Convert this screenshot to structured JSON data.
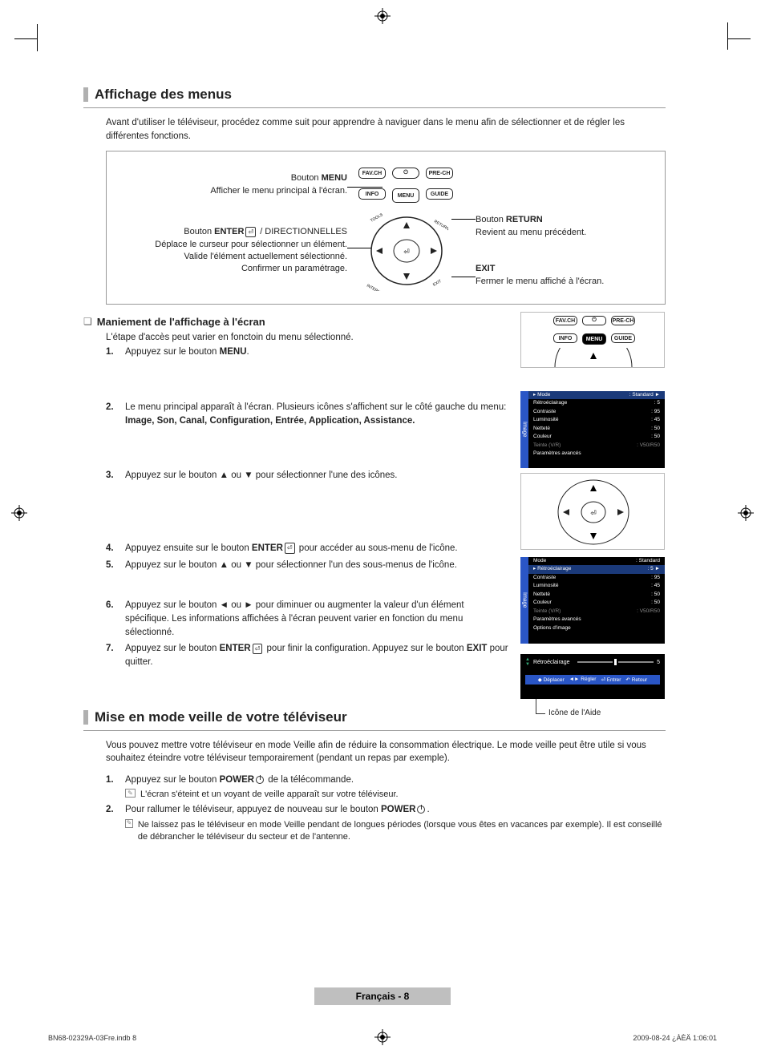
{
  "reg_icon_name": "registration-mark-icon",
  "section1": {
    "title": "Affichage des menus",
    "intro": "Avant d'utiliser le téléviseur, procédez comme suit pour apprendre à naviguer dans le menu afin de sélectionner et de régler les différentes fonctions.",
    "remote": {
      "menu_btn_label": "Bouton ",
      "menu_btn_bold": "MENU",
      "menu_btn_desc": "Afficher le menu principal à l'écran.",
      "enter_btn_label": "Bouton ",
      "enter_btn_bold": "ENTER",
      "enter_btn_suffix": " / DIRECTIONNELLES",
      "enter_desc1": "Déplace le curseur pour sélectionner un élément.",
      "enter_desc2": "Valide l'élément actuellement sélectionné.",
      "enter_desc3": "Confirmer un paramétrage.",
      "return_label": "Bouton ",
      "return_bold": "RETURN",
      "return_desc": "Revient au menu précédent.",
      "exit_bold": "EXIT",
      "exit_desc": "Fermer le menu affiché à l'écran.",
      "btn_favch": "FAV.CH",
      "btn_prech": "PRE-CH",
      "btn_info": "INFO",
      "btn_menu": "MENU",
      "btn_guide": "GUIDE",
      "btn_tools": "TOOLS",
      "btn_return": "RETURN",
      "btn_internet": "INTERNET",
      "btn_exit": "EXIT"
    },
    "sub_title": "Maniement de l'affichage à l'écran",
    "sub_intro": "L'étape d'accès peut varier en fonctoin du menu sélectionné.",
    "steps": {
      "s1a": "Appuyez sur le bouton ",
      "s1b": "MENU",
      "s1c": ".",
      "s2a": "Le menu principal apparaît à l'écran. Plusieurs icônes s'affichent sur le côté gauche du menu: ",
      "s2b": "Image, Son, Canal, Configuration, Entrée, Application, Assistance.",
      "s3": "Appuyez sur le bouton ▲ ou ▼ pour sélectionner l'une des icônes.",
      "s4a": "Appuyez ensuite sur le bouton ",
      "s4b": "ENTER",
      "s4c": " pour accéder au sous-menu de l'icône.",
      "s5": "Appuyez sur le bouton ▲ ou ▼  pour sélectionner l'un des sous-menus de l'icône.",
      "s6": "Appuyez sur le bouton ◄ ou ► pour diminuer ou augmenter la valeur d'un élément spécifique. Les informations affichées à l'écran peuvent varier en fonction du menu sélectionné.",
      "s7a": "Appuyez sur le bouton ",
      "s7b": "ENTER",
      "s7c": " pour finir la configuration. Appuyez sur le bouton ",
      "s7d": "EXIT",
      "s7e": " pour quitter."
    },
    "menu1": {
      "tab": "Image",
      "rows": [
        {
          "l": "Mode",
          "r": ": Standard",
          "hl": true
        },
        {
          "l": "Rétroéclairage",
          "r": ": 5"
        },
        {
          "l": "Contraste",
          "r": ": 95"
        },
        {
          "l": "Luminosité",
          "r": ": 45"
        },
        {
          "l": "Netteté",
          "r": ": 50"
        },
        {
          "l": "Couleur",
          "r": ": 50"
        },
        {
          "l": "Teinte (V/R)",
          "r": ": V50/R50",
          "dim": true
        },
        {
          "l": "Paramètres avancés",
          "r": ""
        }
      ]
    },
    "menu2": {
      "tab": "Image",
      "rows": [
        {
          "l": "Mode",
          "r": ": Standard"
        },
        {
          "l": "Rétroéclairage",
          "r": ": 5",
          "hl": true
        },
        {
          "l": "Contraste",
          "r": ": 95"
        },
        {
          "l": "Luminosité",
          "r": ": 45"
        },
        {
          "l": "Netteté",
          "r": ": 50"
        },
        {
          "l": "Couleur",
          "r": ": 50"
        },
        {
          "l": "Teinte (V/R)",
          "r": ": V50/R50",
          "dim": true
        },
        {
          "l": "Paramètres avancés",
          "r": ""
        },
        {
          "l": "Options d'image",
          "r": ""
        }
      ]
    },
    "slider": {
      "label": "Rétroéclairage",
      "val": "5",
      "help1": "Déplacer",
      "help2": "Régler",
      "help3": "Entrer",
      "help4": "Retour"
    },
    "aide_label": "Icône de l'Aide"
  },
  "section2": {
    "title": "Mise en mode veille de votre téléviseur",
    "intro": "Vous pouvez mettre votre téléviseur en mode Veille afin de réduire la consommation électrique. Le mode veille peut être utile si vous souhaitez éteindre votre téléviseur temporairement (pendant un repas par exemple).",
    "s1a": "Appuyez sur le bouton  ",
    "s1b": "POWER",
    "s1c": " de la télécommande.",
    "n1": "L'écran s'éteint et un voyant de veille apparaît sur votre téléviseur.",
    "s2a": "Pour rallumer le téléviseur, appuyez de nouveau sur le bouton ",
    "s2b": "POWER",
    "s2c": ".",
    "n2": "Ne laissez pas le téléviseur en mode Veille pendant de longues périodes (lorsque vous êtes en vacances par exemple). Il est conseillé de débrancher le téléviseur du secteur et de l'antenne."
  },
  "footer": {
    "page": "Français - 8",
    "left": "BN68-02329A-03Fre.indb   8",
    "right": "2009-08-24   ¿ÀÈÄ 1:06:01"
  }
}
